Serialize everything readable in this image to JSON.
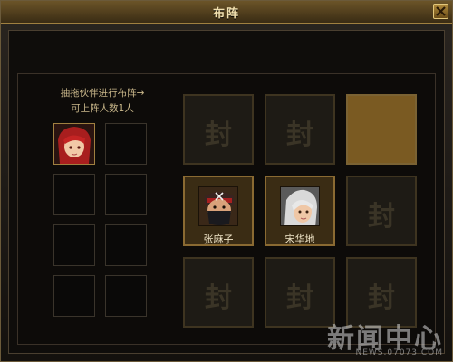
{
  "window": {
    "title": "布阵",
    "close_icon": "close-icon"
  },
  "reserve": {
    "instruction_line1": "抽拖伙伴进行布阵→",
    "instruction_line2": "可上阵人数1人",
    "slots": [
      {
        "filled": true,
        "portrait": "red-hair-girl-portrait"
      },
      {
        "filled": false
      },
      {
        "filled": false
      },
      {
        "filled": false
      },
      {
        "filled": false
      },
      {
        "filled": false
      },
      {
        "filled": false
      },
      {
        "filled": false
      }
    ]
  },
  "formation": {
    "lock_char": "封",
    "cells": [
      {
        "state": "locked"
      },
      {
        "state": "locked"
      },
      {
        "state": "open"
      },
      {
        "state": "occupied",
        "name": "张麻子",
        "portrait": "masked-bandit-portrait"
      },
      {
        "state": "occupied",
        "name": "宋华地",
        "portrait": "white-hair-girl-portrait"
      },
      {
        "state": "locked"
      },
      {
        "state": "locked"
      },
      {
        "state": "locked"
      },
      {
        "state": "locked"
      }
    ]
  },
  "watermark": {
    "text": "新闻中心",
    "sub": "NEWS.07073.COM"
  }
}
